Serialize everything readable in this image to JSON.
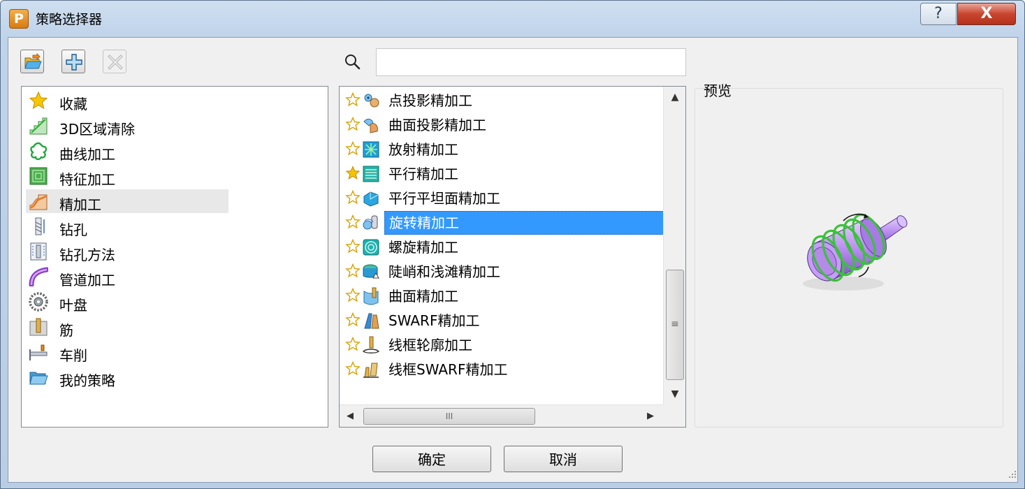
{
  "window": {
    "title": "策略选择器",
    "app_icon_letter": "P",
    "help_glyph": "?",
    "close_glyph": "X"
  },
  "toolbar": {
    "buttons": [
      {
        "name": "open-folder",
        "icon": "open-folder-icon",
        "enabled": true
      },
      {
        "name": "add",
        "icon": "add-icon",
        "enabled": true
      },
      {
        "name": "delete",
        "icon": "delete-icon",
        "enabled": false
      }
    ]
  },
  "categories": {
    "items": [
      {
        "label": "收藏",
        "icon": "star-icon"
      },
      {
        "label": "3D区域清除",
        "icon": "area-clear-icon"
      },
      {
        "label": "曲线加工",
        "icon": "curve-icon"
      },
      {
        "label": "特征加工",
        "icon": "feature-icon"
      },
      {
        "label": "精加工",
        "icon": "finishing-icon",
        "selected": true
      },
      {
        "label": "钻孔",
        "icon": "drill-icon"
      },
      {
        "label": "钻孔方法",
        "icon": "drill-method-icon"
      },
      {
        "label": "管道加工",
        "icon": "pipe-icon"
      },
      {
        "label": "叶盘",
        "icon": "blisk-icon"
      },
      {
        "label": "筋",
        "icon": "rib-icon"
      },
      {
        "label": "车削",
        "icon": "turning-icon"
      },
      {
        "label": "我的策略",
        "icon": "folder-icon"
      }
    ]
  },
  "search": {
    "value": "",
    "placeholder": ""
  },
  "strategies": {
    "items": [
      {
        "label": "点投影精加工",
        "favorite": false
      },
      {
        "label": "曲面投影精加工",
        "favorite": false
      },
      {
        "label": "放射精加工",
        "favorite": false
      },
      {
        "label": "平行精加工",
        "favorite": true
      },
      {
        "label": "平行平坦面精加工",
        "favorite": false
      },
      {
        "label": "旋转精加工",
        "favorite": false,
        "selected": true
      },
      {
        "label": "螺旋精加工",
        "favorite": false
      },
      {
        "label": "陡峭和浅滩精加工",
        "favorite": false
      },
      {
        "label": "曲面精加工",
        "favorite": false
      },
      {
        "label": "SWARF精加工",
        "favorite": false
      },
      {
        "label": "线框轮廓加工",
        "favorite": false
      },
      {
        "label": "线框SWARF精加工",
        "favorite": false
      }
    ]
  },
  "preview": {
    "label": "预览"
  },
  "buttons": {
    "ok": "确定",
    "cancel": "取消"
  },
  "colors": {
    "selection": "#3399ff",
    "favorite_star": "#f5c400",
    "preview_body": "#b98cf0",
    "preview_toolpath": "#3ac23a"
  }
}
